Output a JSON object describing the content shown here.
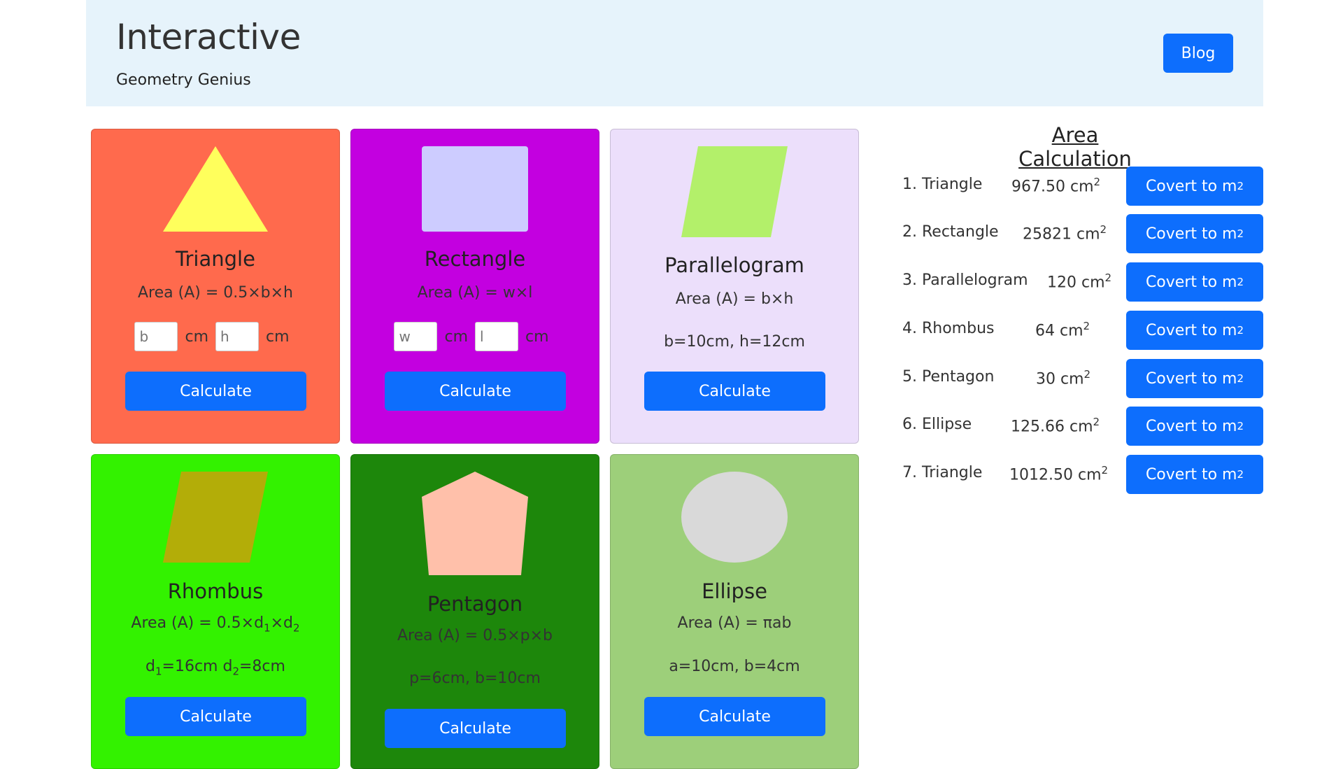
{
  "header": {
    "title": "Interactive",
    "subtitle": "Geometry Genius",
    "blog_label": "Blog"
  },
  "cards": [
    {
      "name": "Triangle",
      "formula": "Area (A) = 0.5×b×h",
      "inputs": [
        {
          "placeholder": "b",
          "unit": "cm"
        },
        {
          "placeholder": "h",
          "unit": "cm"
        }
      ],
      "calc_label": "Calculate",
      "bg": "#ff6a4d",
      "shape_color": "#ffff5c"
    },
    {
      "name": "Rectangle",
      "formula": "Area (A) = w×l",
      "inputs": [
        {
          "placeholder": "w",
          "unit": "cm"
        },
        {
          "placeholder": "l",
          "unit": "cm"
        }
      ],
      "calc_label": "Calculate",
      "bg": "#c300e0",
      "shape_color": "#cdccff"
    },
    {
      "name": "Parallelogram",
      "formula": "Area (A) = b×h",
      "values": "b=10cm, h=12cm",
      "calc_label": "Calculate",
      "bg": "#ecdffb",
      "shape_color": "#b3f06a"
    },
    {
      "name": "Rhombus",
      "formula_prefix": "Area (A) = 0.5×d",
      "formula_mid": "×d",
      "sub1": "1",
      "sub2": "2",
      "values_d1": "d",
      "values_d1_text": "=16cm d",
      "values_d2_text": "=8cm",
      "calc_label": "Calculate",
      "bg": "#33f200",
      "shape_color": "#b3ad08"
    },
    {
      "name": "Pentagon",
      "formula": "Area (A) = 0.5×p×b",
      "values": "p=6cm, b=10cm",
      "calc_label": "Calculate",
      "bg": "#1d870b",
      "shape_color": "#ffc0aa"
    },
    {
      "name": "Ellipse",
      "formula": "Area (A) = πab",
      "values": "a=10cm, b=4cm",
      "calc_label": "Calculate",
      "bg": "#9dcf7a",
      "shape_color": "#d9d9d9"
    }
  ],
  "area_calc": {
    "title": "Area Calculation",
    "unit": "cm",
    "sup": "2",
    "convert_label": "Covert to m",
    "rows": [
      {
        "label": "1. Triangle",
        "value": "967.50"
      },
      {
        "label": "2. Rectangle",
        "value": "25821"
      },
      {
        "label": "3. Parallelogram",
        "value": "120"
      },
      {
        "label": "4. Rhombus",
        "value": "64"
      },
      {
        "label": "5. Pentagon",
        "value": "30"
      },
      {
        "label": "6. Ellipse",
        "value": "125.66"
      },
      {
        "label": "7. Triangle",
        "value": "1012.50"
      }
    ]
  },
  "colors": {
    "primary": "#0d6efd",
    "header_bg": "#e6f3fb"
  }
}
